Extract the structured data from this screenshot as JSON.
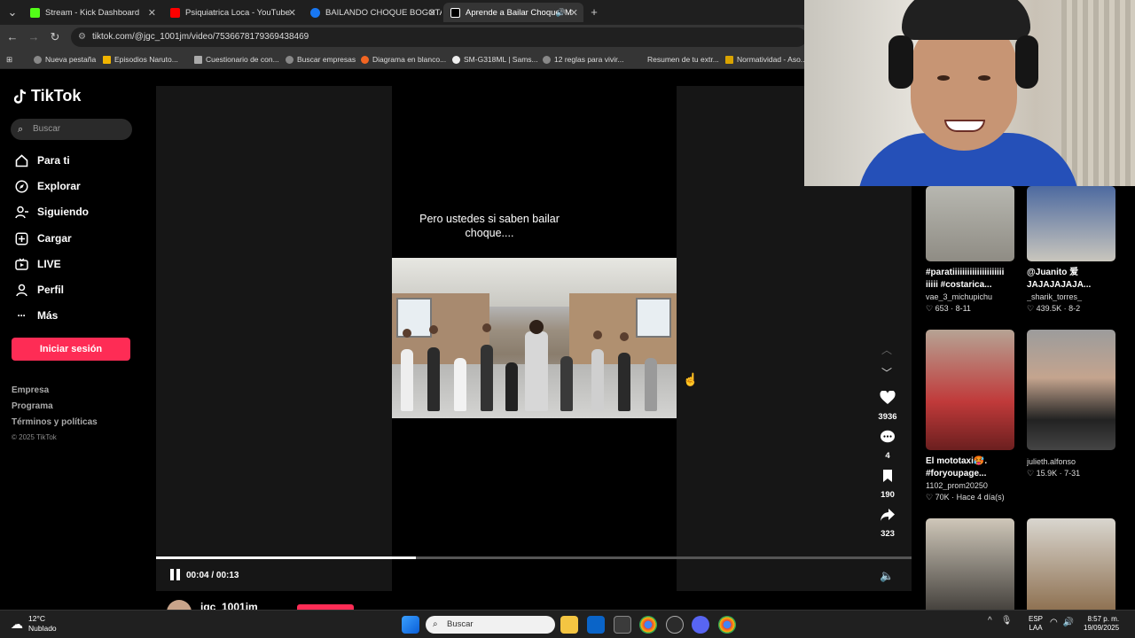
{
  "browser": {
    "tabs": [
      {
        "label": "Stream - Kick Dashboard",
        "color": "#53fc18"
      },
      {
        "label": "Psiquiatrica Loca - YouTube",
        "color": "#ff0000"
      },
      {
        "label": "BAILANDO CHOQUE BOGOTA",
        "color": "#1877f2"
      },
      {
        "label": "Aprende a Bailar Choque: M",
        "color": "#ffffff"
      }
    ],
    "url": "tiktok.com/@jgc_1001jm/video/7536678179369438469",
    "bookmarks": [
      "Nueva pestaña",
      "Episodios Naruto...",
      "Cuestionario de con...",
      "Buscar empresas",
      "Diagrama en blanco...",
      "SM-G318ML | Sams...",
      "12 reglas para vivir...",
      "Resumen de tu extr...",
      "Normatividad - Aso..."
    ]
  },
  "sidebar": {
    "brand": "TikTok",
    "search_placeholder": "Buscar",
    "nav": [
      {
        "label": "Para ti",
        "icon": "home-icon"
      },
      {
        "label": "Explorar",
        "icon": "compass-icon"
      },
      {
        "label": "Siguiendo",
        "icon": "following-icon"
      },
      {
        "label": "Cargar",
        "icon": "upload-icon"
      },
      {
        "label": "LIVE",
        "icon": "live-icon"
      },
      {
        "label": "Perfil",
        "icon": "profile-icon"
      },
      {
        "label": "Más",
        "icon": "more-icon"
      }
    ],
    "login_label": "Iniciar sesión",
    "footer_links": [
      "Empresa",
      "Programa",
      "Términos y políticas"
    ],
    "copyright": "© 2025 TikTok"
  },
  "video": {
    "caption": "Pero ustedes si saben bailar choque....",
    "time": "00:04 / 00:13",
    "progress": 0.344,
    "author": "jgc_1001jm"
  },
  "actions": {
    "likes": "3936",
    "comments": "4",
    "saves": "190",
    "shares": "323"
  },
  "related": [
    {
      "title1": "#paratiiiiiiiiiiiiiiiiiiiii",
      "title2": "iiiii #costarica...",
      "user": "vae_3_michupichu",
      "meta": "♡ 653 · 8-11"
    },
    {
      "title1": "@Juanito 爱",
      "title2": "JAJAJAJAJA...",
      "user": "_sharik_torres_",
      "meta": "♡ 439.5K · 8-2"
    },
    {
      "title1": "El mototaxi🥵.",
      "title2": "#foryoupage...",
      "user": "1102_prom20250",
      "meta": "♡ 70K · Hace 4 día(s)"
    },
    {
      "title1": "",
      "title2": "",
      "user": "julieth.alfonso",
      "meta": "♡ 15.9K · 7-31"
    }
  ],
  "taskbar": {
    "weather_temp": "12°C",
    "weather_desc": "Nublado",
    "search_placeholder": "Buscar",
    "lang1": "ESP",
    "lang2": "LAA",
    "time": "8:57 p. m.",
    "date": "19/09/2025"
  }
}
